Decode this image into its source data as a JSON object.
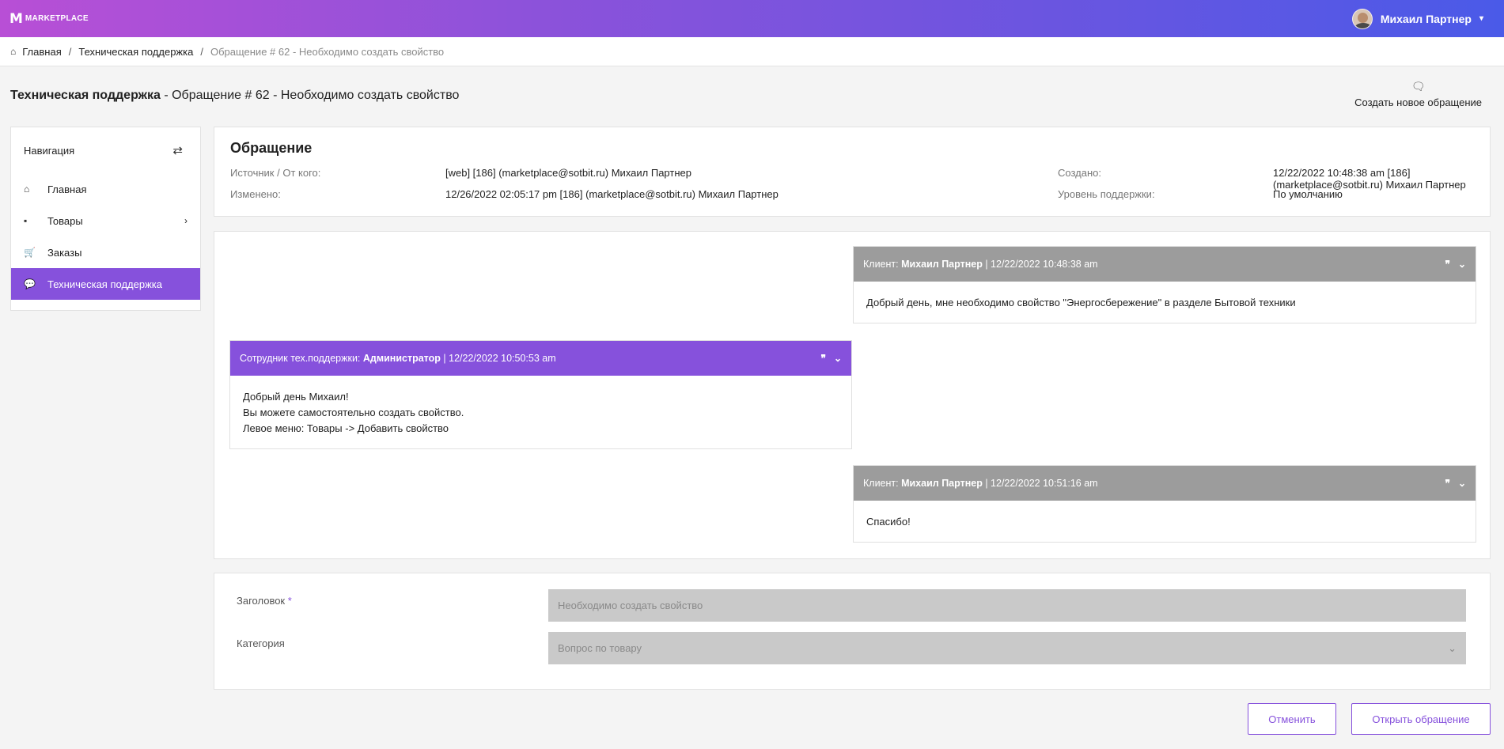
{
  "header": {
    "logo_mark": "M",
    "logo_text": "MARKETPLACE",
    "user_name": "Михаил Партнер",
    "caret": "⌄"
  },
  "breadcrumb": [
    "Главная",
    "Техническая поддержка",
    "Обращение # 62 - Необходимо создать свойство"
  ],
  "page_title": {
    "section": "Техническая поддержка",
    "rest": " - Обращение # 62 - Необходимо создать свойство"
  },
  "new_ticket_label": "Создать новое обращение",
  "sidebar": {
    "title": "Навигация",
    "items": [
      {
        "label": "Главная",
        "icon": "home-icon",
        "glyph": "⌂"
      },
      {
        "label": "Товары",
        "icon": "box-icon",
        "glyph": "▪",
        "has_children": true
      },
      {
        "label": "Заказы",
        "icon": "cart-icon",
        "glyph": "🛒"
      },
      {
        "label": "Техническая поддержка",
        "icon": "chat-icon",
        "glyph": "💬",
        "active": true
      }
    ]
  },
  "ticket": {
    "title": "Обращение",
    "source_label": "Источник / От кого:",
    "source_value": "[web] [186] (marketplace@sotbit.ru) Михаил Партнер",
    "created_label": "Создано:",
    "created_value": "12/22/2022 10:48:38 am [186] (marketplace@sotbit.ru) Михаил Партнер",
    "modified_label": "Изменено:",
    "modified_value": "12/26/2022 02:05:17 pm [186] (marketplace@sotbit.ru) Михаил Партнер",
    "level_label": "Уровень поддержки:",
    "level_value": "По умолчанию"
  },
  "messages": [
    {
      "role_prefix": "Клиент: ",
      "author": "Михаил Партнер",
      "time": " | 12/22/2022 10:48:38 am",
      "lines": [
        "Добрый день, мне необходимо свойство \"Энергосбережение\" в разделе Бытовой техники"
      ]
    },
    {
      "role_prefix": "Сотрудник тех.поддержки: ",
      "author": "Администратор",
      "time": " | 12/22/2022 10:50:53 am",
      "lines": [
        "Добрый день Михаил!",
        "Вы можете самостоятельно создать свойство.",
        "Левое меню: Товары -> Добавить свойство"
      ]
    },
    {
      "role_prefix": "Клиент: ",
      "author": "Михаил Партнер",
      "time": " | 12/22/2022 10:51:16 am",
      "lines": [
        "Спасибо!"
      ]
    }
  ],
  "form": {
    "title_label": "Заголовок",
    "required_mark": "*",
    "title_value": "Необходимо создать свойство",
    "category_label": "Категория",
    "category_value": "Вопрос по товару"
  },
  "buttons": {
    "cancel": "Отменить",
    "open": "Открыть обращение"
  },
  "colors": {
    "accent": "#8651dc",
    "client_header": "#9c9c9c",
    "header_gradient_start": "#b84fd6",
    "header_gradient_end": "#4a5ae8"
  }
}
